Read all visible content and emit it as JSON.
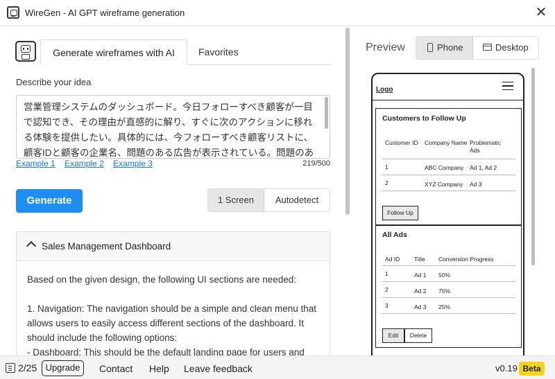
{
  "window": {
    "title": "WireGen - AI GPT wireframe generation"
  },
  "tabs": {
    "generate": "Generate wireframes with AI",
    "favorites": "Favorites"
  },
  "form": {
    "describe_label": "Describe your idea",
    "idea_text": "営業管理システムのダッシュボード。今日フォローすべき顧客が一目で認知でき、その理由が直感的に解り、すぐに次のアクションに移れる体験を提供したい。具体的には、今フォローすべき顧客リストに、顧客IDと顧客の企業名、問題のある広告が表示されている。問題のある広告に",
    "examples": [
      "Example 1",
      "Example 2",
      "Example 3"
    ],
    "char_count": "219/500",
    "generate_label": "Generate",
    "mode_options": [
      "1 Screen",
      "Autodetect"
    ],
    "mode_selected": "1 Screen"
  },
  "result": {
    "title": "Sales Management Dashboard",
    "paragraphs": [
      "Based on the given design, the following UI sections are needed:",
      "1. Navigation: The navigation should be a simple and clean menu that allows users to easily access different sections of the dashboard. It should include the following options:",
      "- Dashboard: This should be the default landing page for users and"
    ]
  },
  "preview": {
    "label": "Preview",
    "phone_label": "Phone",
    "desktop_label": "Desktop",
    "selected": "Phone"
  },
  "wireframe": {
    "logo": "Logo",
    "follow_card": {
      "title": "Customers to Follow Up",
      "headers": [
        "Customer ID",
        "Company Name",
        "Problematic Ads"
      ],
      "rows": [
        [
          "1",
          "ABC Company",
          "Ad 1, Ad 2"
        ],
        [
          "2",
          "XYZ Company",
          "Ad 3"
        ]
      ],
      "button": "Follow Up"
    },
    "ads_card": {
      "title": "All Ads",
      "headers": [
        "Ad ID",
        "Title",
        "Conversion Progress"
      ],
      "rows": [
        [
          "1",
          "Ad 1",
          "50%"
        ],
        [
          "2",
          "Ad 2",
          "75%"
        ],
        [
          "3",
          "Ad 3",
          "25%"
        ]
      ],
      "buttons": [
        "Edit",
        "Delete"
      ]
    }
  },
  "statusbar": {
    "count": "2/25",
    "upgrade": "Upgrade",
    "contact": "Contact",
    "help": "Help",
    "feedback": "Leave feedback",
    "version": "v0.19",
    "beta": "Beta"
  },
  "colors": {
    "accent": "#1e8ef0",
    "beta": "#f6d21a"
  }
}
